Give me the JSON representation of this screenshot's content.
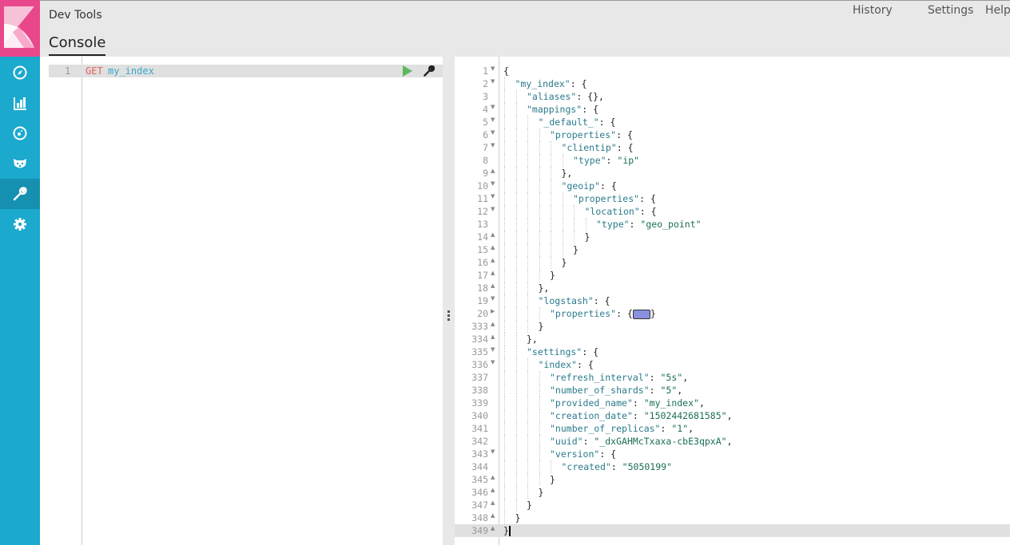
{
  "header": {
    "app_title": "Dev Tools",
    "tab": "Console",
    "menu": [
      "History",
      "Settings",
      "Help"
    ]
  },
  "sidebar": {
    "items": [
      "discover-icon",
      "visualize-icon",
      "dashboard-icon",
      "timelion-icon",
      "devtools-icon",
      "management-icon"
    ],
    "active": "devtools-icon"
  },
  "editor": {
    "lines": [
      {
        "num": "1",
        "method": "GET",
        "path": "my_index"
      }
    ]
  },
  "output": {
    "lines": [
      {
        "n": "1",
        "f": "down",
        "i": 0,
        "t": "{"
      },
      {
        "n": "2",
        "f": "down",
        "i": 1,
        "t": "\"my_index\": {"
      },
      {
        "n": "3",
        "f": "",
        "i": 2,
        "t": "\"aliases\": {},"
      },
      {
        "n": "4",
        "f": "down",
        "i": 2,
        "t": "\"mappings\": {"
      },
      {
        "n": "5",
        "f": "down",
        "i": 3,
        "t": "\"_default_\": {"
      },
      {
        "n": "6",
        "f": "down",
        "i": 4,
        "t": "\"properties\": {"
      },
      {
        "n": "7",
        "f": "down",
        "i": 5,
        "t": "\"clientip\": {"
      },
      {
        "n": "8",
        "f": "",
        "i": 6,
        "t": "\"type\": \"ip\""
      },
      {
        "n": "9",
        "f": "up",
        "i": 5,
        "t": "},"
      },
      {
        "n": "10",
        "f": "down",
        "i": 5,
        "t": "\"geoip\": {"
      },
      {
        "n": "11",
        "f": "down",
        "i": 6,
        "t": "\"properties\": {"
      },
      {
        "n": "12",
        "f": "down",
        "i": 7,
        "t": "\"location\": {"
      },
      {
        "n": "13",
        "f": "",
        "i": 8,
        "t": "\"type\": \"geo_point\""
      },
      {
        "n": "14",
        "f": "up",
        "i": 7,
        "t": "}"
      },
      {
        "n": "15",
        "f": "up",
        "i": 6,
        "t": "}"
      },
      {
        "n": "16",
        "f": "up",
        "i": 5,
        "t": "}"
      },
      {
        "n": "17",
        "f": "up",
        "i": 4,
        "t": "}"
      },
      {
        "n": "18",
        "f": "up",
        "i": 3,
        "t": "},"
      },
      {
        "n": "19",
        "f": "down",
        "i": 3,
        "t": "\"logstash\": {"
      },
      {
        "n": "20",
        "f": "right",
        "i": 4,
        "t": "\"properties\": {",
        "collapsed": true
      },
      {
        "n": "333",
        "f": "up",
        "i": 3,
        "t": "}"
      },
      {
        "n": "334",
        "f": "up",
        "i": 2,
        "t": "},"
      },
      {
        "n": "335",
        "f": "down",
        "i": 2,
        "t": "\"settings\": {"
      },
      {
        "n": "336",
        "f": "down",
        "i": 3,
        "t": "\"index\": {"
      },
      {
        "n": "337",
        "f": "",
        "i": 4,
        "t": "\"refresh_interval\": \"5s\","
      },
      {
        "n": "338",
        "f": "",
        "i": 4,
        "t": "\"number_of_shards\": \"5\","
      },
      {
        "n": "339",
        "f": "",
        "i": 4,
        "t": "\"provided_name\": \"my_index\","
      },
      {
        "n": "340",
        "f": "",
        "i": 4,
        "t": "\"creation_date\": \"1502442681585\","
      },
      {
        "n": "341",
        "f": "",
        "i": 4,
        "t": "\"number_of_replicas\": \"1\","
      },
      {
        "n": "342",
        "f": "",
        "i": 4,
        "t": "\"uuid\": \"_dxGAHMcTxaxa-cbE3qpxA\","
      },
      {
        "n": "343",
        "f": "down",
        "i": 4,
        "t": "\"version\": {"
      },
      {
        "n": "344",
        "f": "",
        "i": 5,
        "t": "\"created\": \"5050199\""
      },
      {
        "n": "345",
        "f": "up",
        "i": 4,
        "t": "}"
      },
      {
        "n": "346",
        "f": "up",
        "i": 3,
        "t": "}"
      },
      {
        "n": "347",
        "f": "up",
        "i": 2,
        "t": "}"
      },
      {
        "n": "348",
        "f": "up",
        "i": 1,
        "t": "}"
      },
      {
        "n": "349",
        "f": "up",
        "i": 0,
        "t": "}",
        "current": true
      }
    ]
  },
  "colors": {
    "sidebar": "#1ba9ce",
    "logo": "#e8488b",
    "method": "#e0605a",
    "url": "#39a9c9",
    "run": "#5cb85c"
  }
}
